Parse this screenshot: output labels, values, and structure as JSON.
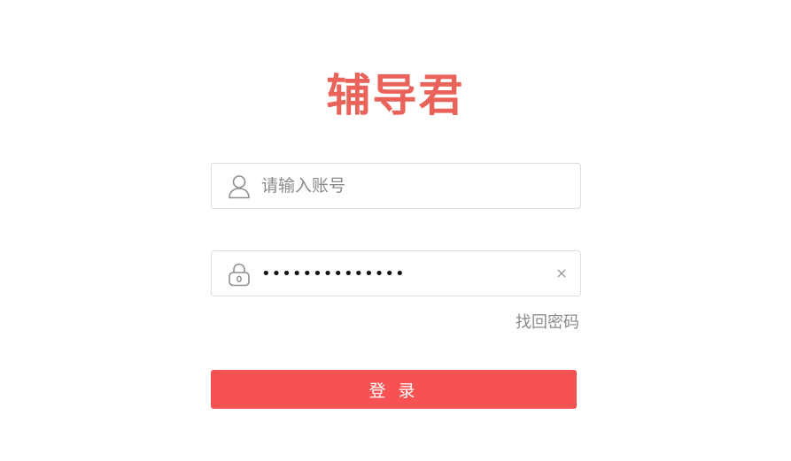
{
  "brand": {
    "logo_text": "辅导君",
    "color": "#e9635a"
  },
  "account": {
    "placeholder": "请输入账号",
    "value": "",
    "icon": "user-icon"
  },
  "password": {
    "value": "••••••••••••••",
    "icon": "lock-icon",
    "clear_label": "×"
  },
  "forgot_password_label": "找回密码",
  "login": {
    "label": "登 录",
    "color": "#f75253"
  }
}
